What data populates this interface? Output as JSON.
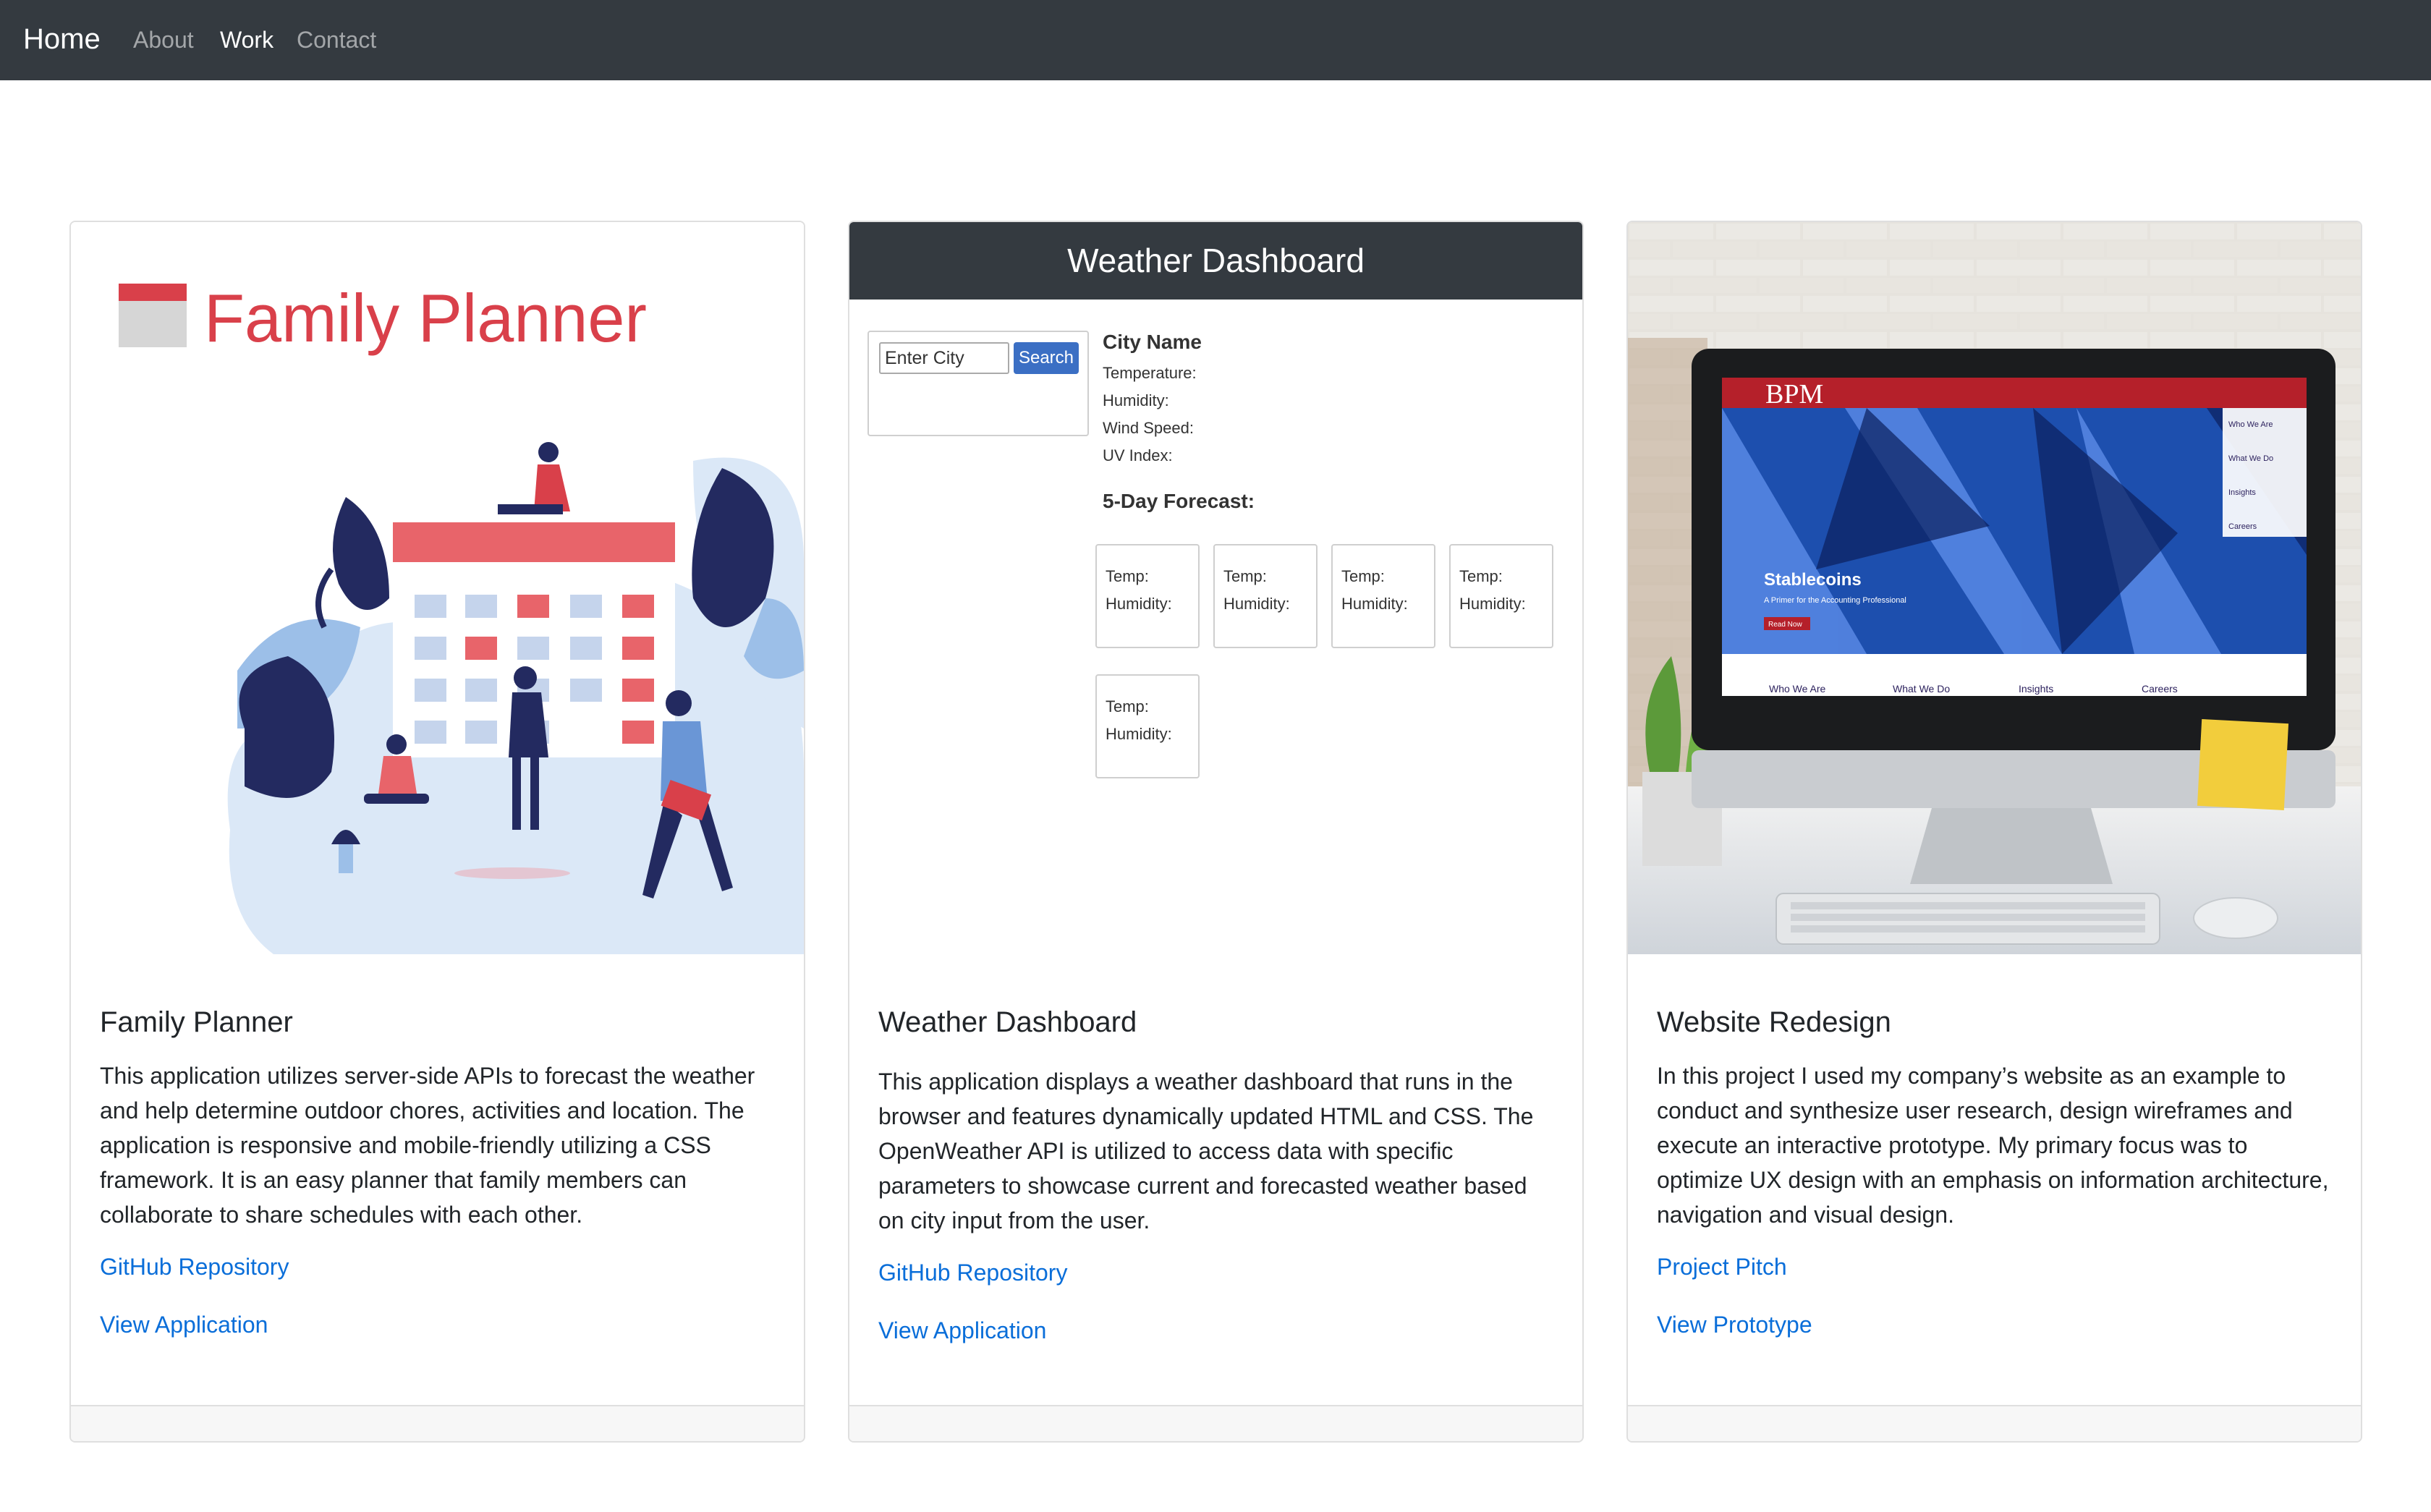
{
  "nav": {
    "brand": "Home",
    "links": [
      "About",
      "Work",
      "Contact"
    ]
  },
  "cards": [
    {
      "title": "Family Planner",
      "logo_text": "Family Planner",
      "text": "This application utilizes server-side APIs to forecast the weather and help determine outdoor chores, activities and location. The application is responsive and mobile-friendly utilizing a CSS framework. It is an easy planner that family members can collaborate to share schedules with each other.",
      "link1": "GitHub Repository",
      "link2": "View Application"
    },
    {
      "title": "Weather Dashboard",
      "text": "This application displays a weather dashboard that runs in the browser and features dynamically updated HTML and CSS. The OpenWeather API is utilized to access data with specific parameters to showcase current and forecasted weather based on city input from the user.",
      "link1": "GitHub Repository",
      "link2": "View Application",
      "mock": {
        "header": "Weather Dashboard",
        "input_placeholder": "Enter City",
        "search": "Search",
        "city": "City Name",
        "fields": [
          "Temperature:",
          "Humidity:",
          "Wind Speed:",
          "UV Index:"
        ],
        "forecast_title": "5-Day Forecast:",
        "temp": "Temp:",
        "humidity": "Humidity:"
      }
    },
    {
      "title": "Website Redesign",
      "text": "In this project I used my company’s website as an example to conduct and synthesize user research, design wireframes and execute an interactive prototype. My primary focus was to optimize UX design with an emphasis on information architecture, navigation and visual design.",
      "link1": "Project Pitch",
      "link2": "View Prototype",
      "screen": {
        "logo": "BPM",
        "hero_title": "Stablecoins",
        "hero_sub": "A Primer for the Accounting Professional",
        "btn": "Read Now",
        "menu": [
          "Who We Are",
          "What We Do",
          "Insights",
          "Careers"
        ],
        "bottom": [
          "Who We Are",
          "What We Do",
          "Insights",
          "Careers"
        ]
      }
    }
  ],
  "colors": {
    "navbar": "#343a40",
    "link": "#0a6ed9",
    "planner_red": "#d9404a",
    "planner_navy": "#232a60",
    "bpm_red": "#b5202a"
  }
}
